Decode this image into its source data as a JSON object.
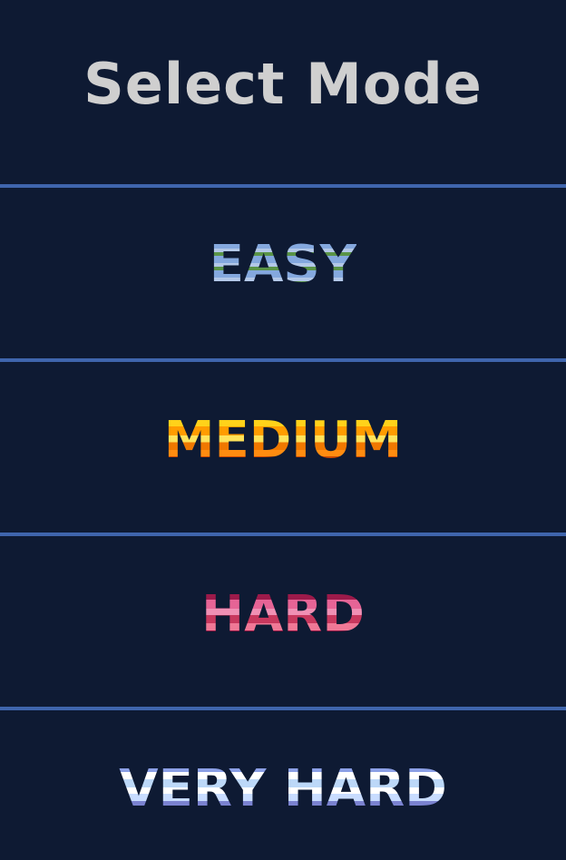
{
  "screen": {
    "title": "Select Mode"
  },
  "modes": [
    {
      "label": "EASY"
    },
    {
      "label": "MEDIUM"
    },
    {
      "label": "HARD"
    },
    {
      "label": "VERY HARD"
    }
  ],
  "colors": {
    "background": "#0e1a33",
    "divider": "#3f65ad",
    "title": "#cfcfcf",
    "easy": "#84a8de",
    "medium": "#ff9c00",
    "hard": "#e66496",
    "very_hard": "#bcd8f8"
  }
}
